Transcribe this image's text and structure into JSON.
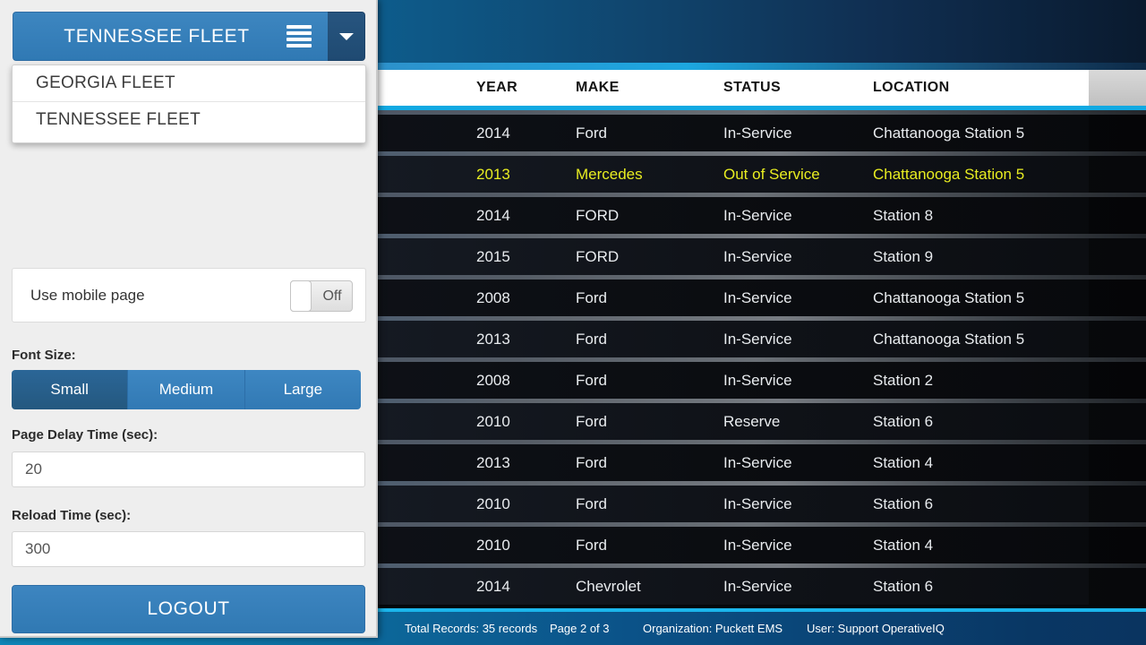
{
  "sidebar": {
    "fleet_selector": {
      "current": "TENNESSEE FLEET",
      "menu_icon": "hamburger-icon",
      "caret_icon": "caret-down-icon",
      "options": [
        "GEORGIA FLEET",
        "TENNESSEE FLEET"
      ]
    },
    "mobile_page": {
      "label": "Use mobile page",
      "toggle_state": "Off"
    },
    "font_size": {
      "label": "Font Size:",
      "options": [
        "Small",
        "Medium",
        "Large"
      ],
      "selected": "Small"
    },
    "page_delay": {
      "label": "Page Delay Time (sec):",
      "value": "20"
    },
    "reload_time": {
      "label": "Reload Time (sec):",
      "value": "300"
    },
    "logout_label": "LOGOUT"
  },
  "table": {
    "columns": [
      "YEAR",
      "MAKE",
      "STATUS",
      "LOCATION"
    ],
    "rows": [
      {
        "year": "2014",
        "make": "Ford",
        "status": "In-Service",
        "location": "Chattanooga Station 5",
        "highlight": false
      },
      {
        "year": "2013",
        "make": "Mercedes",
        "status": "Out of Service",
        "location": "Chattanooga Station 5",
        "highlight": true
      },
      {
        "year": "2014",
        "make": "FORD",
        "status": "In-Service",
        "location": "Station 8",
        "highlight": false
      },
      {
        "year": "2015",
        "make": "FORD",
        "status": "In-Service",
        "location": "Station 9",
        "highlight": false
      },
      {
        "year": "2008",
        "make": "Ford",
        "status": "In-Service",
        "location": "Chattanooga Station 5",
        "highlight": false
      },
      {
        "year": "2013",
        "make": "Ford",
        "status": "In-Service",
        "location": "Chattanooga Station 5",
        "highlight": false
      },
      {
        "year": "2008",
        "make": "Ford",
        "status": "In-Service",
        "location": "Station 2",
        "highlight": false
      },
      {
        "year": "2010",
        "make": "Ford",
        "status": "Reserve",
        "location": "Station 6",
        "highlight": false
      },
      {
        "year": "2013",
        "make": "Ford",
        "status": "In-Service",
        "location": "Station 4",
        "highlight": false
      },
      {
        "year": "2010",
        "make": "Ford",
        "status": "In-Service",
        "location": "Station 6",
        "highlight": false
      },
      {
        "year": "2010",
        "make": "Ford",
        "status": "In-Service",
        "location": "Station 4",
        "highlight": false
      },
      {
        "year": "2014",
        "make": "Chevrolet",
        "status": "In-Service",
        "location": "Station 6",
        "highlight": false
      }
    ]
  },
  "footer": {
    "total_records": "Total Records: 35 records",
    "page": "Page 2 of 3",
    "organization": "Organization: Puckett EMS",
    "user": "User: Support OperativeIQ"
  },
  "colors": {
    "accent_blue": "#3079b4",
    "dark_blue": "#1f4a72",
    "cyan_rule": "#11a9e2",
    "highlight_yellow": "#e8ed21"
  }
}
